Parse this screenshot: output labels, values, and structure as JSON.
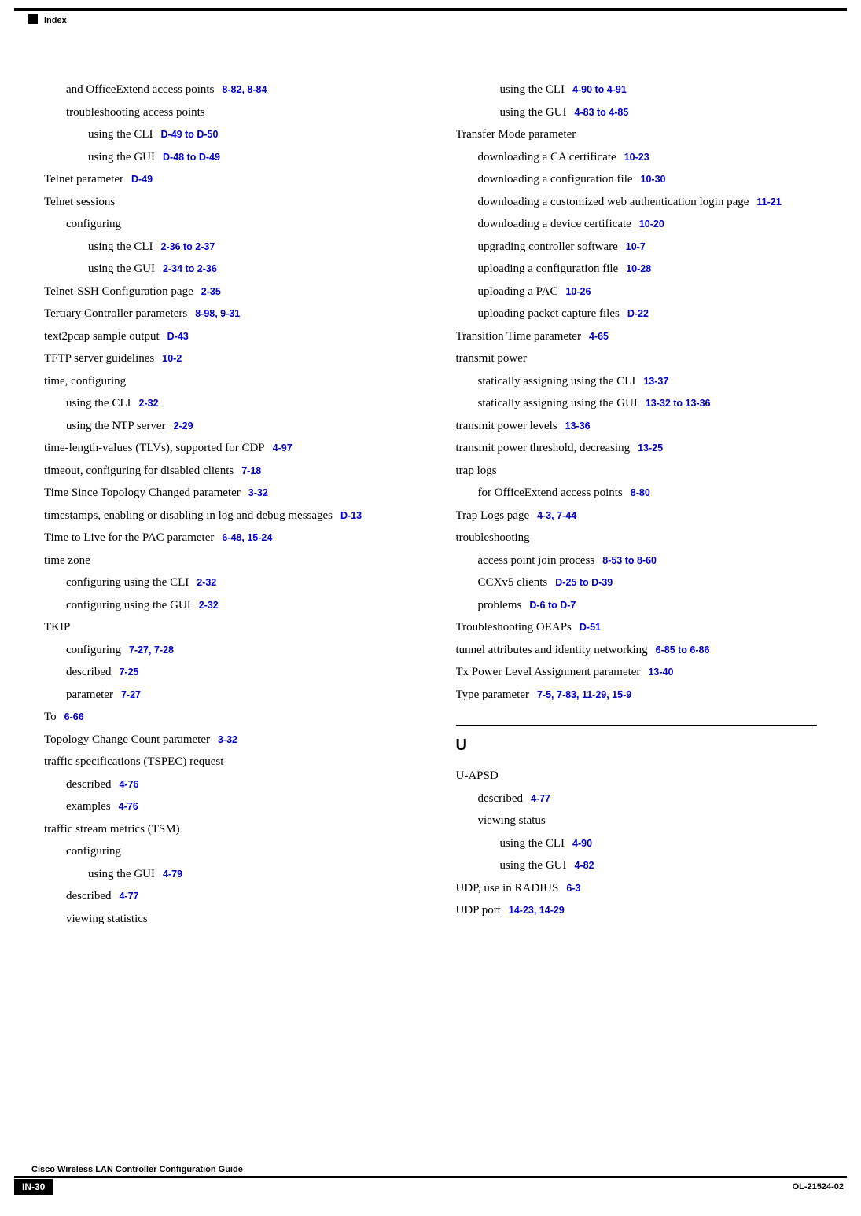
{
  "header": {
    "label": "Index"
  },
  "footer": {
    "title": "Cisco Wireless LAN Controller Configuration Guide",
    "page": "IN-30",
    "docid": "OL-21524-02"
  },
  "left": [
    {
      "lvl": 1,
      "text": "and OfficeExtend access points",
      "ref": "8-82, 8-84"
    },
    {
      "lvl": 1,
      "text": "troubleshooting access points",
      "ref": ""
    },
    {
      "lvl": 2,
      "text": "using the CLI",
      "ref": "D-49 to D-50"
    },
    {
      "lvl": 2,
      "text": "using the GUI",
      "ref": "D-48 to D-49"
    },
    {
      "lvl": 0,
      "text": "Telnet parameter",
      "ref": "D-49"
    },
    {
      "lvl": 0,
      "text": "Telnet sessions",
      "ref": ""
    },
    {
      "lvl": 1,
      "text": "configuring",
      "ref": ""
    },
    {
      "lvl": 2,
      "text": "using the CLI",
      "ref": "2-36 to 2-37"
    },
    {
      "lvl": 2,
      "text": "using the GUI",
      "ref": "2-34 to 2-36"
    },
    {
      "lvl": 0,
      "text": "Telnet-SSH Configuration page",
      "ref": "2-35"
    },
    {
      "lvl": 0,
      "text": "Tertiary Controller parameters",
      "ref": "8-98, 9-31"
    },
    {
      "lvl": 0,
      "text": "text2pcap sample output",
      "ref": "D-43"
    },
    {
      "lvl": 0,
      "text": "TFTP server guidelines",
      "ref": "10-2"
    },
    {
      "lvl": 0,
      "text": "time, configuring",
      "ref": ""
    },
    {
      "lvl": 1,
      "text": "using the CLI",
      "ref": "2-32"
    },
    {
      "lvl": 1,
      "text": "using the NTP server",
      "ref": "2-29"
    },
    {
      "lvl": 0,
      "text": "time-length-values (TLVs), supported for CDP",
      "ref": "4-97"
    },
    {
      "lvl": 0,
      "text": "timeout, configuring for disabled clients",
      "ref": "7-18"
    },
    {
      "lvl": 0,
      "text": "Time Since Topology Changed parameter",
      "ref": "3-32"
    },
    {
      "lvl": 0,
      "text": "timestamps, enabling or disabling in log and debug messages",
      "ref": "D-13",
      "wrap": true
    },
    {
      "lvl": 0,
      "text": "Time to Live for the PAC parameter",
      "ref": "6-48, 15-24"
    },
    {
      "lvl": 0,
      "text": "time zone",
      "ref": ""
    },
    {
      "lvl": 1,
      "text": "configuring using the CLI",
      "ref": "2-32"
    },
    {
      "lvl": 1,
      "text": "configuring using the GUI",
      "ref": "2-32"
    },
    {
      "lvl": 0,
      "text": "TKIP",
      "ref": ""
    },
    {
      "lvl": 1,
      "text": "configuring",
      "ref": "7-27, 7-28"
    },
    {
      "lvl": 1,
      "text": "described",
      "ref": "7-25"
    },
    {
      "lvl": 1,
      "text": "parameter",
      "ref": "7-27"
    },
    {
      "lvl": 0,
      "text": "To",
      "ref": "6-66"
    },
    {
      "lvl": 0,
      "text": "Topology Change Count parameter",
      "ref": "3-32"
    },
    {
      "lvl": 0,
      "text": "traffic specifications (TSPEC) request",
      "ref": ""
    },
    {
      "lvl": 1,
      "text": "described",
      "ref": "4-76"
    },
    {
      "lvl": 1,
      "text": "examples",
      "ref": "4-76"
    },
    {
      "lvl": 0,
      "text": "traffic stream metrics (TSM)",
      "ref": ""
    },
    {
      "lvl": 1,
      "text": "configuring",
      "ref": ""
    },
    {
      "lvl": 2,
      "text": "using the GUI",
      "ref": "4-79"
    },
    {
      "lvl": 1,
      "text": "described",
      "ref": "4-77"
    },
    {
      "lvl": 1,
      "text": "viewing statistics",
      "ref": ""
    }
  ],
  "right": [
    {
      "lvl": 2,
      "text": "using the CLI",
      "ref": "4-90 to 4-91"
    },
    {
      "lvl": 2,
      "text": "using the GUI",
      "ref": "4-83 to 4-85"
    },
    {
      "lvl": 0,
      "text": "Transfer Mode parameter",
      "ref": ""
    },
    {
      "lvl": 1,
      "text": "downloading a CA certificate",
      "ref": "10-23"
    },
    {
      "lvl": 1,
      "text": "downloading a configuration file",
      "ref": "10-30"
    },
    {
      "lvl": 1,
      "text": "downloading a customized web authentication login page",
      "ref": "11-21",
      "wrap": true
    },
    {
      "lvl": 1,
      "text": "downloading a device certificate",
      "ref": "10-20"
    },
    {
      "lvl": 1,
      "text": "upgrading controller software",
      "ref": "10-7"
    },
    {
      "lvl": 1,
      "text": "uploading a configuration file",
      "ref": "10-28"
    },
    {
      "lvl": 1,
      "text": "uploading a PAC",
      "ref": "10-26"
    },
    {
      "lvl": 1,
      "text": "uploading packet capture files",
      "ref": "D-22"
    },
    {
      "lvl": 0,
      "text": "Transition Time parameter",
      "ref": "4-65"
    },
    {
      "lvl": 0,
      "text": "transmit power",
      "ref": ""
    },
    {
      "lvl": 1,
      "text": "statically assigning using the CLI",
      "ref": "13-37"
    },
    {
      "lvl": 1,
      "text": "statically assigning using the GUI",
      "ref": "13-32 to 13-36"
    },
    {
      "lvl": 0,
      "text": "transmit power levels",
      "ref": "13-36"
    },
    {
      "lvl": 0,
      "text": "transmit power threshold, decreasing",
      "ref": "13-25"
    },
    {
      "lvl": 0,
      "text": "trap logs",
      "ref": ""
    },
    {
      "lvl": 1,
      "text": "for OfficeExtend access points",
      "ref": "8-80"
    },
    {
      "lvl": 0,
      "text": "Trap Logs page",
      "ref": "4-3, 7-44"
    },
    {
      "lvl": 0,
      "text": "troubleshooting",
      "ref": ""
    },
    {
      "lvl": 1,
      "text": "access point join process",
      "ref": "8-53 to 8-60"
    },
    {
      "lvl": 1,
      "text": "CCXv5 clients",
      "ref": "D-25 to D-39"
    },
    {
      "lvl": 1,
      "text": "problems",
      "ref": "D-6 to D-7"
    },
    {
      "lvl": 0,
      "text": "Troubleshooting OEAPs",
      "ref": "D-51"
    },
    {
      "lvl": 0,
      "text": "tunnel attributes and identity networking",
      "ref": "6-85 to 6-86"
    },
    {
      "lvl": 0,
      "text": "Tx Power Level Assignment parameter",
      "ref": "13-40"
    },
    {
      "lvl": 0,
      "text": "Type parameter",
      "ref": "7-5, 7-83, 11-29, 15-9"
    }
  ],
  "section": {
    "letter": "U"
  },
  "right2": [
    {
      "lvl": 0,
      "text": "U-APSD",
      "ref": ""
    },
    {
      "lvl": 1,
      "text": "described",
      "ref": "4-77"
    },
    {
      "lvl": 1,
      "text": "viewing status",
      "ref": ""
    },
    {
      "lvl": 2,
      "text": "using the CLI",
      "ref": "4-90"
    },
    {
      "lvl": 2,
      "text": "using the GUI",
      "ref": "4-82"
    },
    {
      "lvl": 0,
      "text": "UDP, use in RADIUS",
      "ref": "6-3"
    },
    {
      "lvl": 0,
      "text": "UDP port",
      "ref": "14-23, 14-29"
    }
  ]
}
